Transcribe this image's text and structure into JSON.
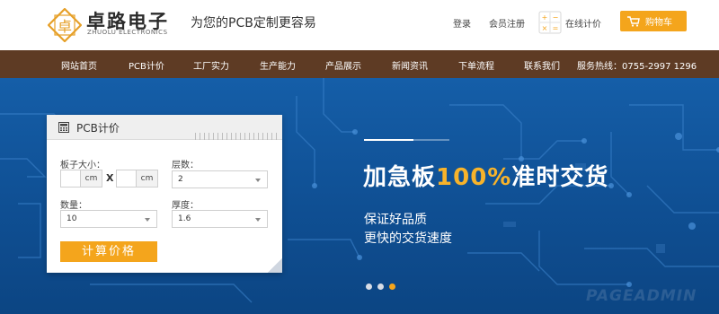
{
  "header": {
    "logo_char": "卓",
    "brand_cn": "卓路电子",
    "brand_en": "ZHUOLU ELECTRONICS",
    "slogan": "为您的PCB定制更容易",
    "login": "登录",
    "register": "会员注册",
    "online_quote": "在线计价",
    "cart": "购物车",
    "logo_icon": "pcb-seal-logo",
    "calc_icon": "calculator-icon",
    "cart_icon": "cart-icon"
  },
  "nav": {
    "items": [
      "网站首页",
      "PCB计价",
      "工厂实力",
      "生产能力",
      "产品展示",
      "新闻资讯",
      "下单流程",
      "联系我们"
    ],
    "hotline": "服务热线：0755-2997 1296"
  },
  "banner": {
    "headline_pre": "加急板",
    "headline_hl": "100%",
    "headline_post": "准时交货",
    "sub1": "保证好品质",
    "sub2": "更快的交货速度",
    "watermark": "PAGEADMIN",
    "slides": 3,
    "active_slide": 3
  },
  "quote": {
    "title": "PCB计价",
    "size_label": "板子大小：",
    "layers_label": "层数：",
    "unit": "cm",
    "x": "X",
    "width_value": "",
    "height_value": "",
    "layers_value": "2",
    "qty_label": "数量：",
    "qty_value": "10",
    "thickness_label": "厚度：",
    "thickness_value": "1.6",
    "button": "计算价格"
  },
  "colors": {
    "accent": "#f4a51c",
    "nav_bg": "#5e3b24",
    "banner_bg": "#155ea8",
    "highlight": "#f7b32b"
  }
}
